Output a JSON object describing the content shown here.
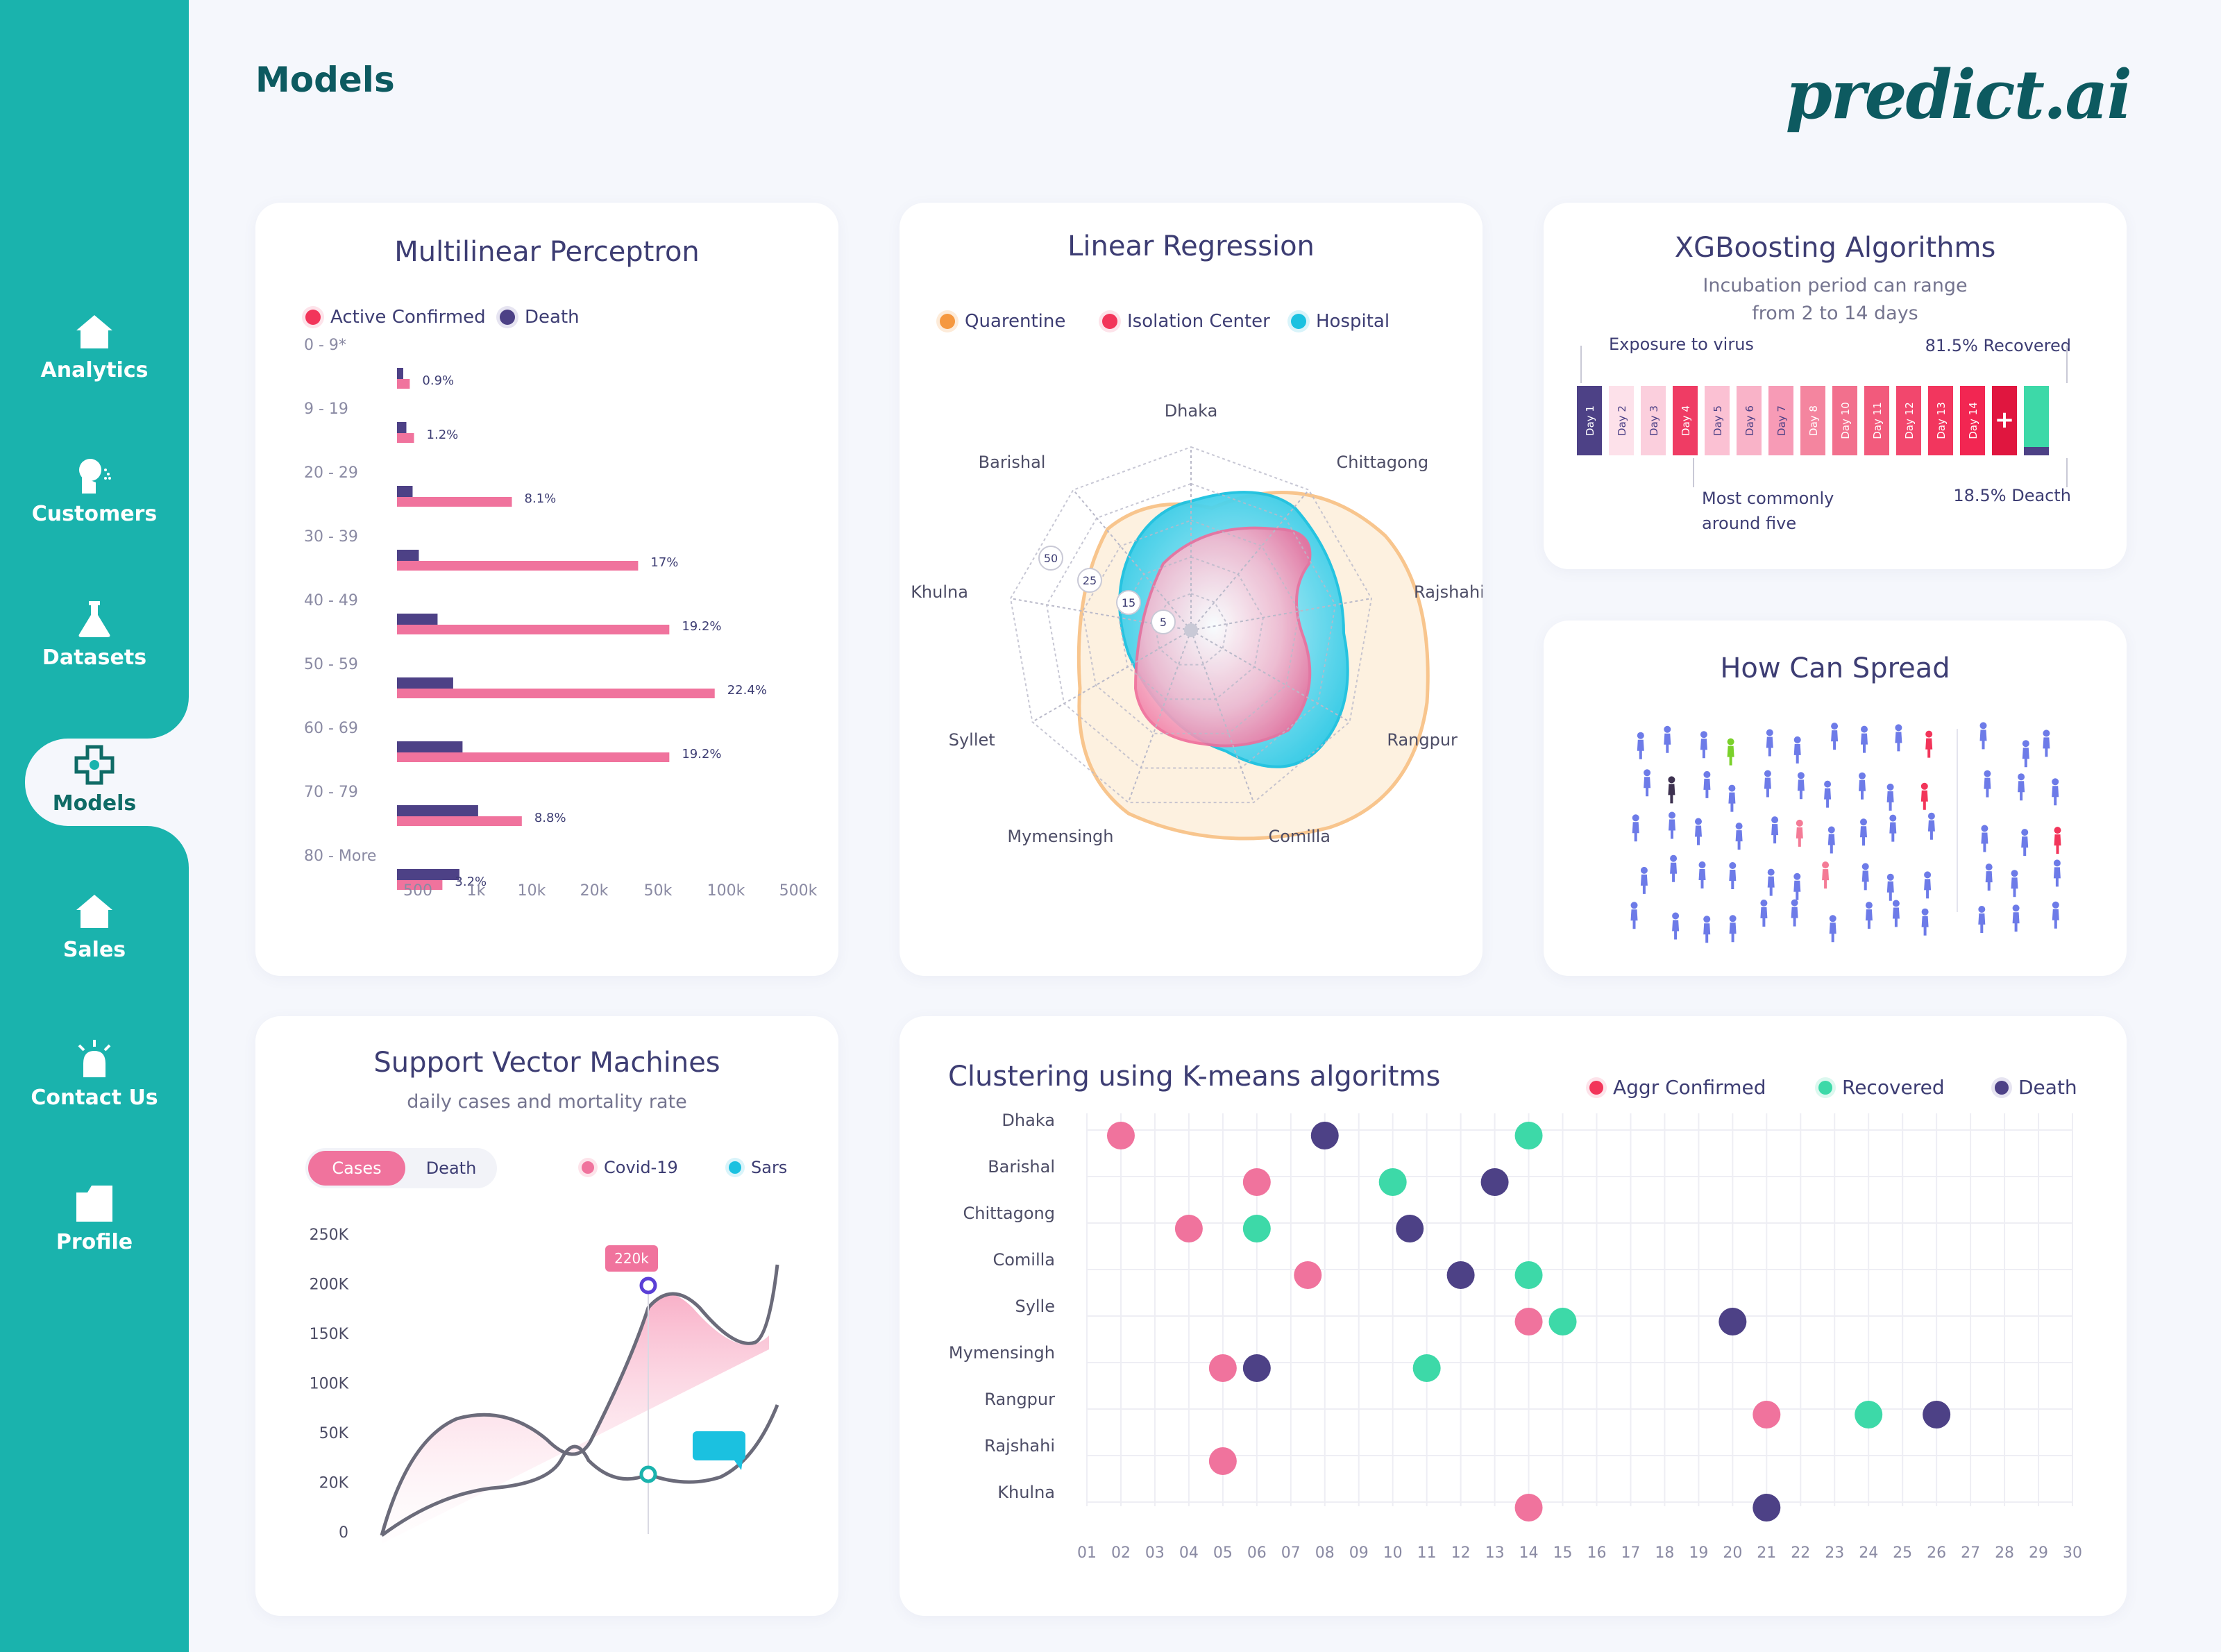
{
  "page": {
    "title": "Models",
    "logo": "predict.ai"
  },
  "sidebar": {
    "items": [
      {
        "label": "Analytics",
        "icon": "home-icon"
      },
      {
        "label": "Customers",
        "icon": "person-sneeze-icon"
      },
      {
        "label": "Datasets",
        "icon": "flask-icon"
      },
      {
        "label": "Models",
        "icon": "medical-cross-icon",
        "active": true
      },
      {
        "label": "Sales",
        "icon": "home-icon"
      },
      {
        "label": "Contact Us",
        "icon": "alarm-light-icon"
      },
      {
        "label": "Profile",
        "icon": "profile-card-icon"
      }
    ]
  },
  "colors": {
    "teal": "#1ab3ad",
    "pink": "#f0739d",
    "purple": "#4d4186",
    "green": "#3dd9a8",
    "cyan": "#1bc1e0",
    "orange": "#f59840",
    "red": "#f2355a"
  },
  "mlp": {
    "title": "Multilinear Perceptron",
    "legend": [
      "Active Confirmed",
      "Death"
    ],
    "chart_data": {
      "type": "bar",
      "categories": [
        "0 - 9*",
        "9 - 19",
        "20 - 29",
        "30 - 39",
        "40 - 49",
        "50 - 59",
        "60 - 69",
        "70 - 79",
        "80 - More"
      ],
      "series": [
        {
          "name": "Active Confirmed",
          "values": [
            0.9,
            1.2,
            8.1,
            17,
            19.2,
            22.4,
            19.2,
            8.8,
            3.2
          ]
        },
        {
          "name": "Death",
          "values": [
            0.2,
            0.3,
            0.5,
            0.7,
            1.3,
            1.8,
            2.1,
            2.6,
            2.0
          ]
        }
      ],
      "labels": [
        "0.9%",
        "1.2%",
        "8.1%",
        "17%",
        "19.2%",
        "22.4%",
        "19.2%",
        "8.8%",
        "3.2%"
      ],
      "xticks": [
        "500",
        "1k",
        "10k",
        "20k",
        "50k",
        "100k",
        "500k"
      ]
    }
  },
  "linreg": {
    "title": "Linear Regression",
    "legend": [
      "Quarentine",
      "Isolation Center",
      "Hospital"
    ],
    "chart_data": {
      "type": "radar",
      "axes": [
        "Dhaka",
        "Chittagong",
        "Rajshahi",
        "Rangpur",
        "Comilla",
        "Mymensingh",
        "Syllet",
        "Khulna",
        "Barishal"
      ],
      "rings": [
        "50",
        "25",
        "15",
        "5"
      ]
    }
  },
  "xgb": {
    "title": "XGBoosting Algorithms",
    "subtitle1": "Incubation period can range",
    "subtitle2": "from 2 to 14 days",
    "exposure": "Exposure to virus",
    "recovered": "81.5% Recovered",
    "common1": "Most commonly",
    "common2": "around five",
    "death": "18.5% Deacth",
    "days": [
      "Day 1",
      "Day 2",
      "Day 3",
      "Day 4",
      "Day 5",
      "Day 6",
      "Day 7",
      "Day 8",
      "Day 10",
      "Day 11",
      "Day 12",
      "Day 13",
      "Day 14"
    ],
    "plus": "+"
  },
  "spread": {
    "title": "How Can Spread"
  },
  "svm": {
    "title": "Support Vector Machines",
    "subtitle": "daily cases and mortality rate",
    "tabs": [
      "Cases",
      "Death"
    ],
    "legend": [
      "Covid-19",
      "Sars"
    ],
    "tooltip": "220k",
    "chart_data": {
      "type": "line",
      "yticks": [
        "250K",
        "200K",
        "150K",
        "100K",
        "50K",
        "20K",
        "0"
      ]
    }
  },
  "kmeans": {
    "title": "Clustering using K-means algoritms",
    "legend": [
      "Aggr Confirmed",
      "Recovered",
      "Death"
    ],
    "chart_data": {
      "type": "scatter",
      "categories": [
        "Dhaka",
        "Barishal",
        "Chittagong",
        "Comilla",
        "Sylle",
        "Mymensingh",
        "Rangpur",
        "Rajshahi",
        "Khulna"
      ],
      "xticks": [
        "01",
        "02",
        "03",
        "04",
        "05",
        "06",
        "07",
        "08",
        "09",
        "10",
        "11",
        "12",
        "13",
        "14",
        "15",
        "16",
        "17",
        "18",
        "19",
        "20",
        "21",
        "22",
        "23",
        "24",
        "25",
        "26",
        "27",
        "28",
        "29",
        "30"
      ],
      "series": [
        {
          "name": "Aggr Confirmed",
          "points": [
            [
              2,
              0
            ],
            [
              6,
              1
            ],
            [
              4,
              2
            ],
            [
              7.5,
              3
            ],
            [
              14,
              4
            ],
            [
              5,
              5
            ],
            [
              21,
              6
            ],
            [
              5,
              7
            ],
            [
              14,
              8
            ]
          ]
        },
        {
          "name": "Recovered",
          "points": [
            [
              14,
              0
            ],
            [
              10,
              1
            ],
            [
              6,
              2
            ],
            [
              14,
              3
            ],
            [
              15,
              4
            ],
            [
              11,
              5
            ],
            [
              24,
              6
            ]
          ]
        },
        {
          "name": "Death",
          "points": [
            [
              8,
              0
            ],
            [
              13,
              1
            ],
            [
              10.5,
              2
            ],
            [
              12,
              3
            ],
            [
              20,
              4
            ],
            [
              6,
              5
            ],
            [
              26,
              6
            ],
            [
              21,
              8
            ]
          ]
        }
      ]
    }
  }
}
